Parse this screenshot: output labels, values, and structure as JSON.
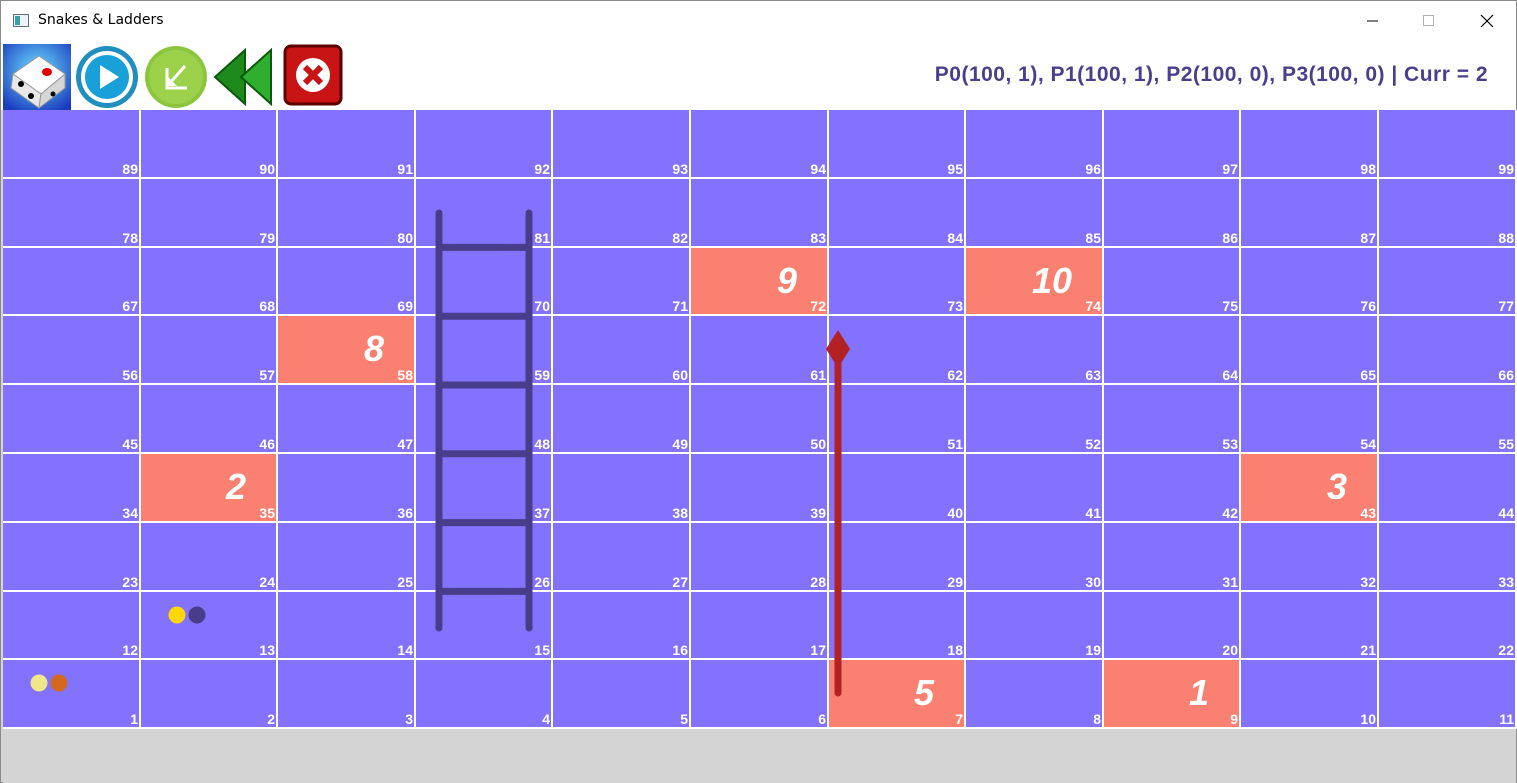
{
  "window": {
    "title": "Snakes & Ladders"
  },
  "toolbar": {
    "buttons": [
      {
        "name": "dice-roll-button",
        "icon": "dice-icon"
      },
      {
        "name": "play-button",
        "icon": "play-icon"
      },
      {
        "name": "load-button",
        "icon": "arrow-down-left-icon"
      },
      {
        "name": "rewind-button",
        "icon": "rewind-icon"
      },
      {
        "name": "close-game-button",
        "icon": "close-icon"
      }
    ],
    "status": "P0(100, 1), P1(100, 1), P2(100, 0), P3(100, 0) | Curr = 2"
  },
  "board": {
    "rows": [
      [
        89,
        90,
        91,
        92,
        93,
        94,
        95,
        96,
        97,
        98,
        99
      ],
      [
        78,
        79,
        80,
        81,
        82,
        83,
        84,
        85,
        86,
        87,
        88
      ],
      [
        67,
        68,
        69,
        70,
        71,
        72,
        73,
        74,
        75,
        76,
        77
      ],
      [
        56,
        57,
        58,
        59,
        60,
        61,
        62,
        63,
        64,
        65,
        66
      ],
      [
        45,
        46,
        47,
        48,
        49,
        50,
        51,
        52,
        53,
        54,
        55
      ],
      [
        34,
        35,
        36,
        37,
        38,
        39,
        40,
        41,
        42,
        43,
        44
      ],
      [
        23,
        24,
        25,
        26,
        27,
        28,
        29,
        30,
        31,
        32,
        33
      ],
      [
        12,
        13,
        14,
        15,
        16,
        17,
        18,
        19,
        20,
        21,
        22
      ],
      [
        1,
        2,
        3,
        4,
        5,
        6,
        7,
        8,
        9,
        10,
        11
      ]
    ],
    "special_cells": [
      {
        "cell": 9,
        "label": "1"
      },
      {
        "cell": 35,
        "label": "2"
      },
      {
        "cell": 43,
        "label": "3"
      },
      {
        "cell": 7,
        "label": "5"
      },
      {
        "cell": 58,
        "label": "8"
      },
      {
        "cell": 72,
        "label": "9"
      },
      {
        "cell": 74,
        "label": "10"
      }
    ],
    "ladders": [
      {
        "from": 15,
        "to": 81
      }
    ],
    "snakes": [
      {
        "head": 62,
        "tail": 7
      }
    ],
    "players": [
      {
        "cell": 1,
        "color": "#f0e68c"
      },
      {
        "cell": 1,
        "color": "#d2691e"
      },
      {
        "cell": 13,
        "color": "#ffd700"
      },
      {
        "cell": 13,
        "color": "#483d8b"
      }
    ]
  },
  "colors": {
    "board": "#8372fe",
    "special": "#fa8072",
    "ladder": "#483d8b",
    "snake": "#b22222",
    "status_text": "#4b3e8c"
  }
}
